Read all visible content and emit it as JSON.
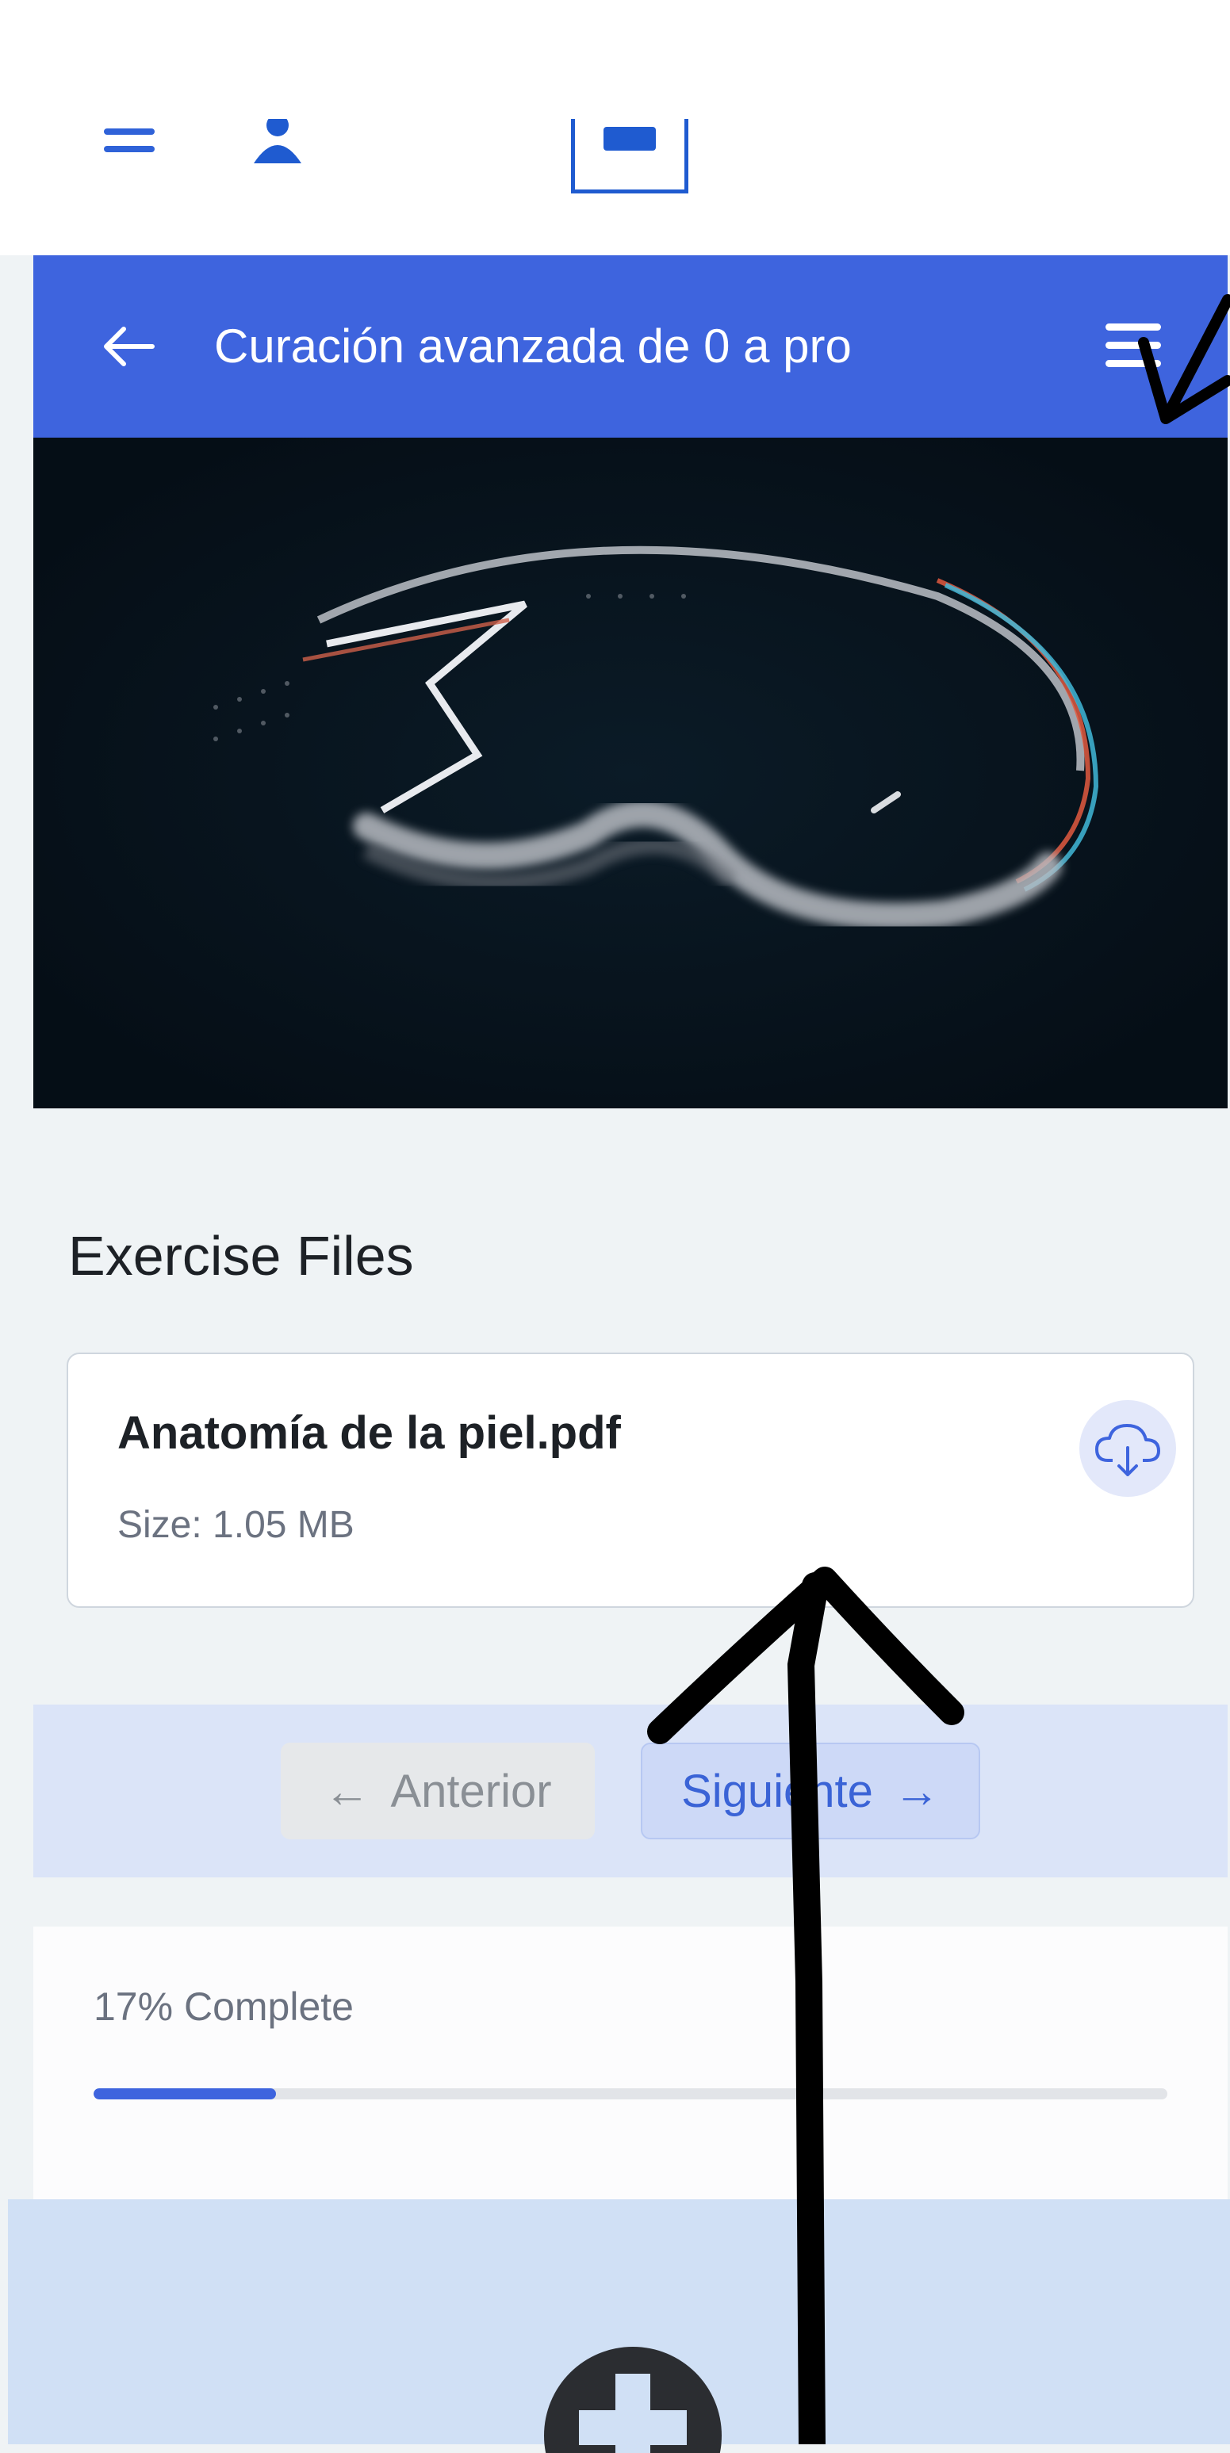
{
  "top_bar": {
    "icons": [
      "menu-icon",
      "user-icon",
      "logo-icon"
    ]
  },
  "course_header": {
    "title": "Curación avanzada de 0 a pro",
    "back_icon": "←",
    "menu_icon": "hamburger-menu"
  },
  "media": {
    "description_icon": "video-thumbnail"
  },
  "exercise_files": {
    "heading": "Exercise Files",
    "files": [
      {
        "name": "Anatomía de la piel.pdf",
        "size": "Size: 1.05 MB",
        "action_icon": "cloud-download-icon"
      }
    ]
  },
  "pagination": {
    "prev_arrow": "←",
    "prev_label": "Anterior",
    "next_label": "Siguiente",
    "next_arrow": "→"
  },
  "progress": {
    "label": "17% Complete",
    "value": 0.17
  },
  "colors": {
    "brand_blue": "#3e64de",
    "page_bg": "#eff3f5",
    "pagination_bg": "#dbe4f8",
    "footer_bg": "#d0e0f5"
  }
}
